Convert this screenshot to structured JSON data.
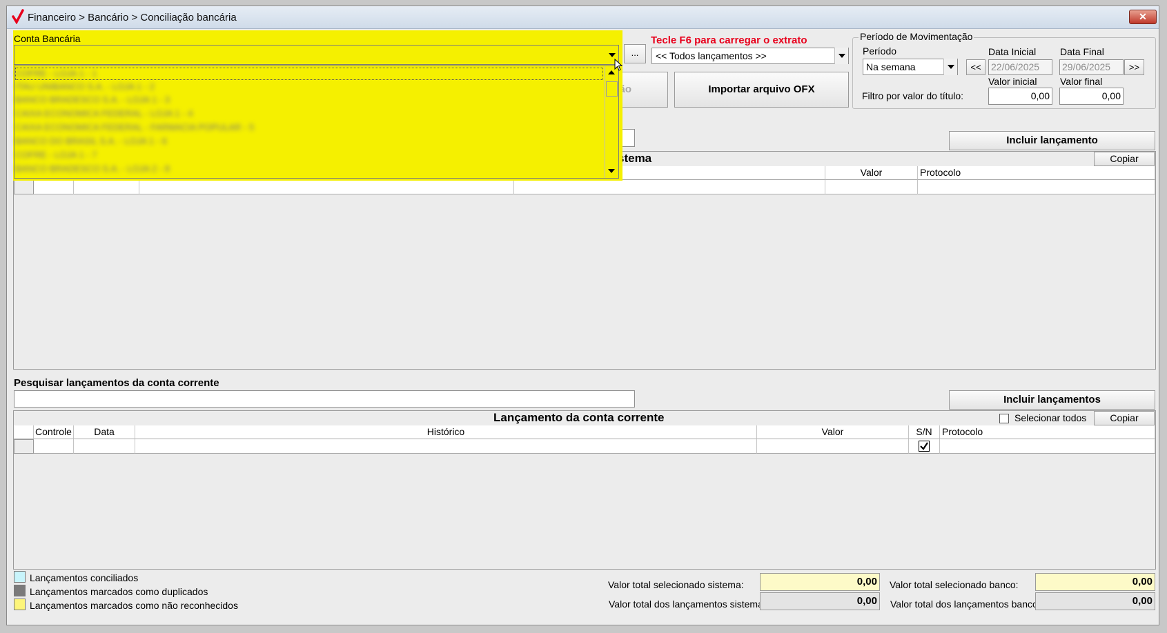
{
  "window": {
    "title": "Financeiro > Bancário > Conciliação bancária",
    "close_label": "✕"
  },
  "conta": {
    "label": "Conta Bancária",
    "ellipsis": "...",
    "options": [
      "COFRE - LOJA 1 - 1",
      "ITAU UNIBANCO S.A. - LOJA 1 - 2",
      "BANCO BRADESCO S.A. - LOJA 1 - 3",
      "CAIXA ECONOMICA FEDERAL - LOJA 1 - 4",
      "CAIXA ECONOMICA FEDERAL - FARMACIA POPULAR - 5",
      "BANCO DO BRASIL S.A. - LOJA 1 - 6",
      "COFRE - LOJA 1 - 7",
      "BANCO BRADESCO S.A. - LOJA 2 - 8"
    ]
  },
  "extrato": {
    "hint": "Tecle F6 para carregar o extrato",
    "filter_value": "<< Todos lançamentos >>"
  },
  "buttons": {
    "hidden_partial": "ão",
    "importar": "Importar arquivo OFX",
    "incluir_lancamento": "Incluir lançamento",
    "copiar_top": "Copiar",
    "incluir_lancamentos": "Incluir lançamentos",
    "copiar_bottom": "Copiar"
  },
  "periodo": {
    "group_title": "Período de Movimentação",
    "periodo_label": "Período",
    "periodo_value": "Na semana",
    "data_inicial_label": "Data Inicial",
    "data_inicial": "22/06/2025",
    "data_final_label": "Data Final",
    "data_final": "29/06/2025",
    "prev": "<<",
    "next": ">>",
    "valor_inicial_label": "Valor inicial",
    "valor_final_label": "Valor final",
    "filtro_label": "Filtro por valor do título:",
    "valor_inicial": "0,00",
    "valor_final": "0,00"
  },
  "sistema_grid": {
    "title_partial": "stema",
    "columns": [
      "Valor",
      "Protocolo"
    ]
  },
  "conta_corrente": {
    "search_label": "Pesquisar lançamentos da conta corrente",
    "title": "Lançamento da conta corrente",
    "selecionar_todos": "Selecionar todos",
    "columns": [
      "Controle",
      "Data",
      "Histórico",
      "Valor",
      "S/N",
      "Protocolo"
    ]
  },
  "legend": [
    {
      "label": "Lançamentos conciliados",
      "color": "#c8f4fb"
    },
    {
      "label": "Lançamentos marcados como duplicados",
      "color": "#7a7a7a"
    },
    {
      "label": "Lançamentos marcados como não reconhecidos",
      "color": "#fdf57a"
    }
  ],
  "totals": {
    "sel_sistema_label": "Valor total selecionado sistema:",
    "sel_sistema": "0,00",
    "sel_banco_label": "Valor total selecionado banco:",
    "sel_banco": "0,00",
    "tot_sistema_label": "Valor total dos lançamentos sistema:",
    "tot_sistema": "0,00",
    "tot_banco_label": "Valor total dos lançamentos banco:",
    "tot_banco": "0,00"
  },
  "colors": {
    "accent_red": "#e8001c",
    "dropdown_yellow": "#f5f000"
  }
}
